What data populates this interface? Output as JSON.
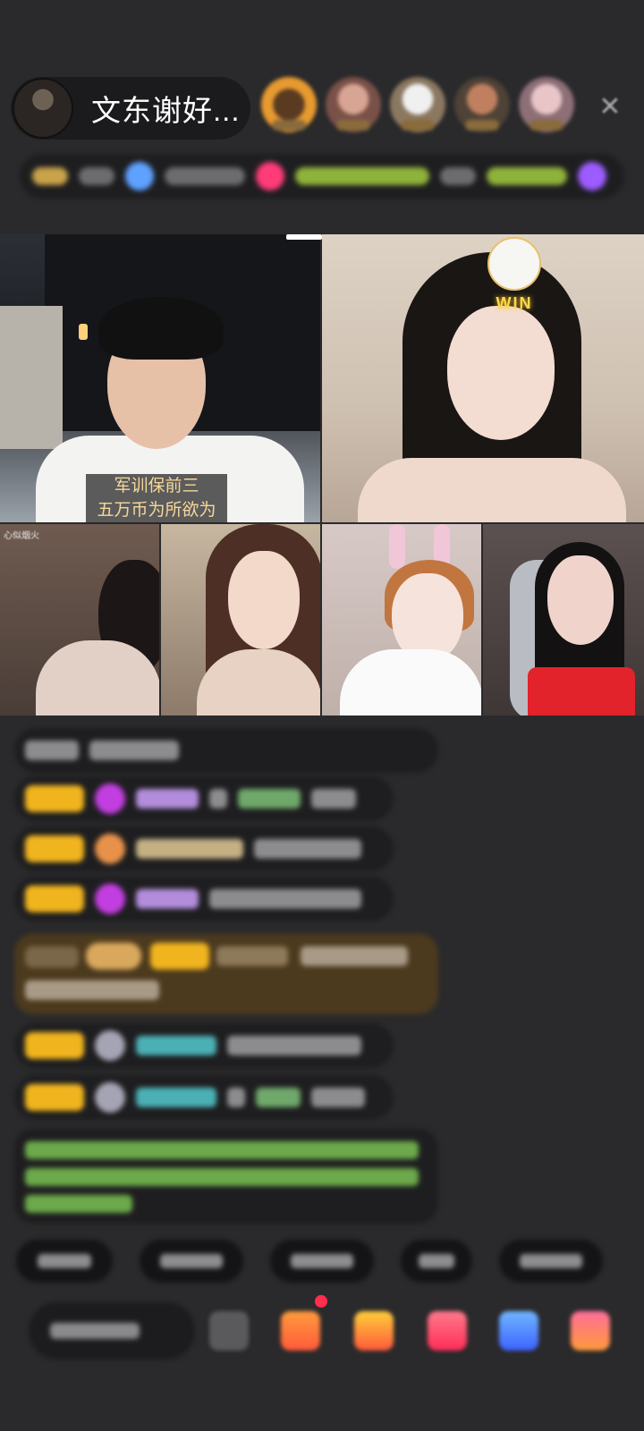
{
  "header": {
    "host_name": "文东谢好...",
    "viewers": [
      "viewer-1",
      "viewer-2",
      "viewer-3",
      "viewer-4",
      "viewer-5"
    ],
    "close_icon": "close-icon"
  },
  "status_bar": {
    "icons": [
      "rank-icon",
      "star-icon",
      "gift-icon",
      "badge-icon"
    ]
  },
  "video": {
    "main_subtitle_line1": "军训保前三",
    "main_subtitle_line2": "五万币为所欲为",
    "sticker_text": "WIN",
    "tile1_label": "心似烟火"
  },
  "chat": {
    "rows": 8
  },
  "colors": {
    "badge": "#f0b41e",
    "highlight": "#4c3a1e",
    "green_text": "#6ca94a",
    "accent_red": "#ff2d4e"
  },
  "bottom": {
    "icons": [
      "more-icon",
      "gift-box-icon",
      "treasure-icon",
      "heart-gift-icon",
      "game-icon",
      "grid-app-icon"
    ]
  }
}
